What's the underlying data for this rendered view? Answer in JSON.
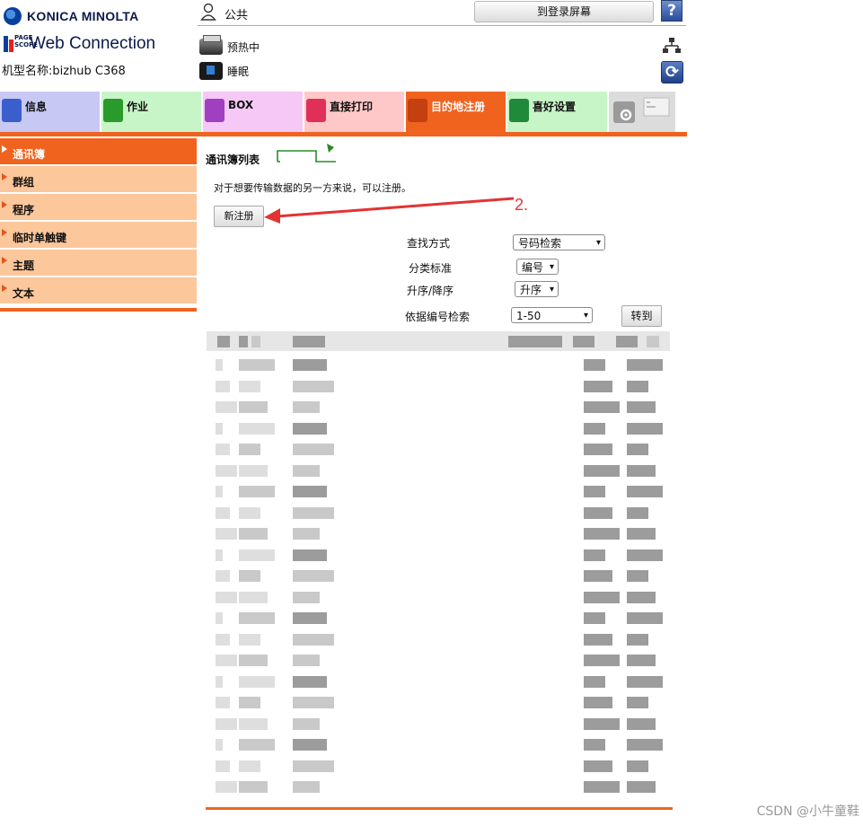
{
  "header": {
    "brand": "KONICA MINOLTA",
    "product": "Web Connection",
    "pagescope_mark": "PAGE SCOPE",
    "model_label": "机型名称:bizhub C368",
    "user_label": "公共",
    "login_button": "到登录屏幕",
    "help_label": "?",
    "status": [
      {
        "label": "预热中",
        "icon": "printer-icon"
      },
      {
        "label": "睡眠",
        "icon": "sleep-icon"
      }
    ],
    "refresh_label": "⟳"
  },
  "tabs": [
    {
      "label": "信息",
      "color": "#c8c8f5",
      "icon_color": "#3a5fcd"
    },
    {
      "label": "作业",
      "color": "#c8f5c8",
      "icon_color": "#2a9a2a"
    },
    {
      "label": "BOX",
      "color": "#f5c8f5",
      "icon_color": "#a040c0"
    },
    {
      "label": "直接打印",
      "color": "#ffc8c8",
      "icon_color": "#e0305a"
    },
    {
      "label": "目的地注册",
      "color": "#f0631f",
      "icon_color": "#c44010",
      "active": true
    },
    {
      "label": "喜好设置",
      "color": "#c8f5c8",
      "icon_color": "#1f8a3a"
    }
  ],
  "sidebar": {
    "items": [
      {
        "label": "通讯簿",
        "active": true
      },
      {
        "label": "群组"
      },
      {
        "label": "程序"
      },
      {
        "label": "临时单触键"
      },
      {
        "label": "主题"
      },
      {
        "label": "文本"
      }
    ]
  },
  "main": {
    "title": "通讯簿列表",
    "description": "对于想要传输数据的另一方来说，可以注册。",
    "new_button": "新注册",
    "annotation": "2.",
    "search": {
      "method_label": "查找方式",
      "method_value": "号码检索",
      "category_label": "分类标准",
      "category_value": "编号",
      "order_label": "升序/降序",
      "order_value": "升序",
      "range_label": "依据编号检索",
      "range_value": "1-50",
      "go_button": "转到"
    }
  },
  "watermark": "CSDN @小牛童鞋",
  "colors": {
    "accent": "#f0631f",
    "sidebar_bg": "#fcc79b",
    "annotation": "#e33333"
  }
}
